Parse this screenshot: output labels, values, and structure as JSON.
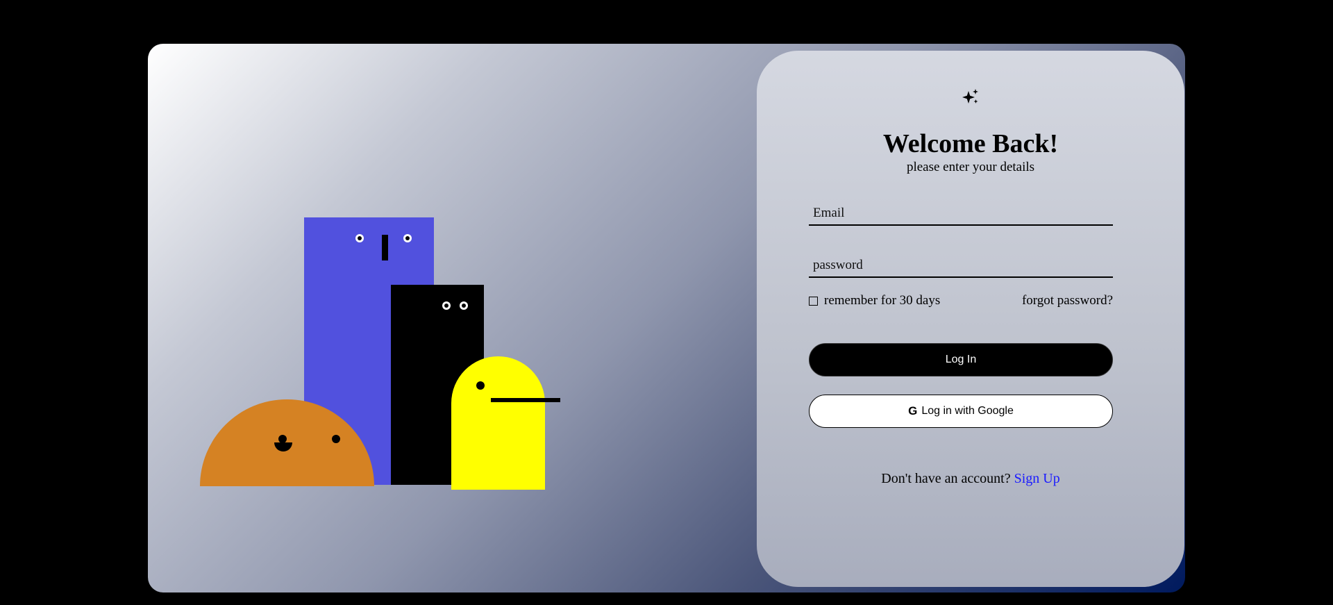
{
  "login": {
    "icon": "sparkle-icon",
    "title": "Welcome Back!",
    "subtitle": "please enter your details",
    "email_placeholder": "Email",
    "password_placeholder": "password",
    "remember_label": "remember for 30 days",
    "forgot_label": "forgot password?",
    "login_button": "Log In",
    "google_icon": "G",
    "google_button": "Log in with Google",
    "signup_prompt": "Don't have an account?",
    "signup_link": "Sign Up"
  },
  "colors": {
    "purple_character": "#5151de",
    "black_character": "#000000",
    "yellow_character": "#ffff00",
    "orange_character": "#d58223",
    "link": "#1a1aff",
    "primary_button": "#000000"
  }
}
